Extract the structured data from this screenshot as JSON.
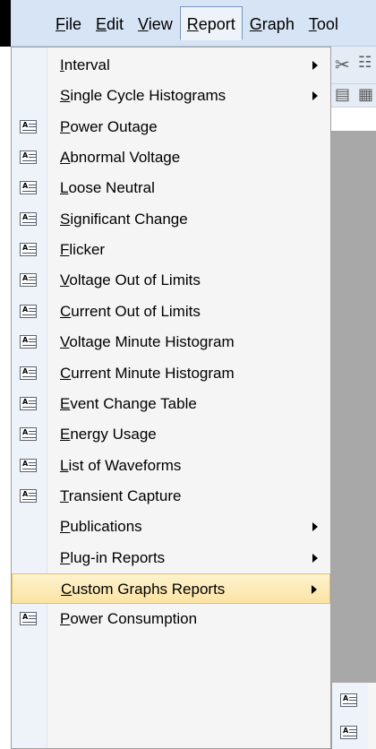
{
  "menubar": {
    "items": [
      {
        "label": "File",
        "mnemonic": "F"
      },
      {
        "label": "Edit",
        "mnemonic": "E"
      },
      {
        "label": "View",
        "mnemonic": "V"
      },
      {
        "label": "Report",
        "mnemonic": "R"
      },
      {
        "label": "Graph",
        "mnemonic": "G"
      },
      {
        "label": "Tool",
        "mnemonic": "T"
      }
    ],
    "active": "Report"
  },
  "toolbar": {
    "icons": [
      "scissors-icon",
      "copy-icon",
      "wave-icon",
      "tile-icon"
    ]
  },
  "report_menu": {
    "items": [
      {
        "label": "Interval",
        "icon": null,
        "submenu": true
      },
      {
        "label": "Single Cycle Histograms",
        "icon": null,
        "submenu": true
      },
      {
        "label": "Power Outage",
        "icon": "report-icon",
        "submenu": false
      },
      {
        "label": "Abnormal Voltage",
        "icon": "report-icon",
        "submenu": false
      },
      {
        "label": "Loose Neutral",
        "icon": "report-icon",
        "submenu": false
      },
      {
        "label": "Significant Change",
        "icon": "report-icon",
        "submenu": false
      },
      {
        "label": "Flicker",
        "icon": "report-icon",
        "submenu": false
      },
      {
        "label": "Voltage Out of Limits",
        "icon": "report-icon",
        "submenu": false
      },
      {
        "label": "Current Out of Limits",
        "icon": "report-icon",
        "submenu": false
      },
      {
        "label": "Voltage Minute Histogram",
        "icon": "report-icon",
        "submenu": false
      },
      {
        "label": "Current Minute Histogram",
        "icon": "report-icon",
        "submenu": false
      },
      {
        "label": "Event Change Table",
        "icon": "report-icon",
        "submenu": false
      },
      {
        "label": "Energy Usage",
        "icon": "report-icon",
        "submenu": false
      },
      {
        "label": "List of Waveforms",
        "icon": "report-icon",
        "submenu": false
      },
      {
        "label": "Transient Capture",
        "icon": "report-icon",
        "submenu": false
      },
      {
        "label": "Publications",
        "icon": null,
        "submenu": true
      },
      {
        "label": "Plug-in Reports",
        "icon": null,
        "submenu": true
      },
      {
        "label": "Custom Graphs Reports",
        "icon": null,
        "submenu": true,
        "highlighted": true
      },
      {
        "label": "Power Consumption",
        "icon": "report-icon",
        "submenu": false
      }
    ]
  },
  "custom_graphs_submenu": {
    "icons": [
      "report-icon",
      "report-icon"
    ]
  },
  "colors": {
    "menubar_bg": "#d6e4f5",
    "menu_bg": "#f5f5f5",
    "highlight_bg": "#fbe3a3",
    "highlight_border": "#e5c365",
    "workspace_gray": "#a8a8a8"
  }
}
